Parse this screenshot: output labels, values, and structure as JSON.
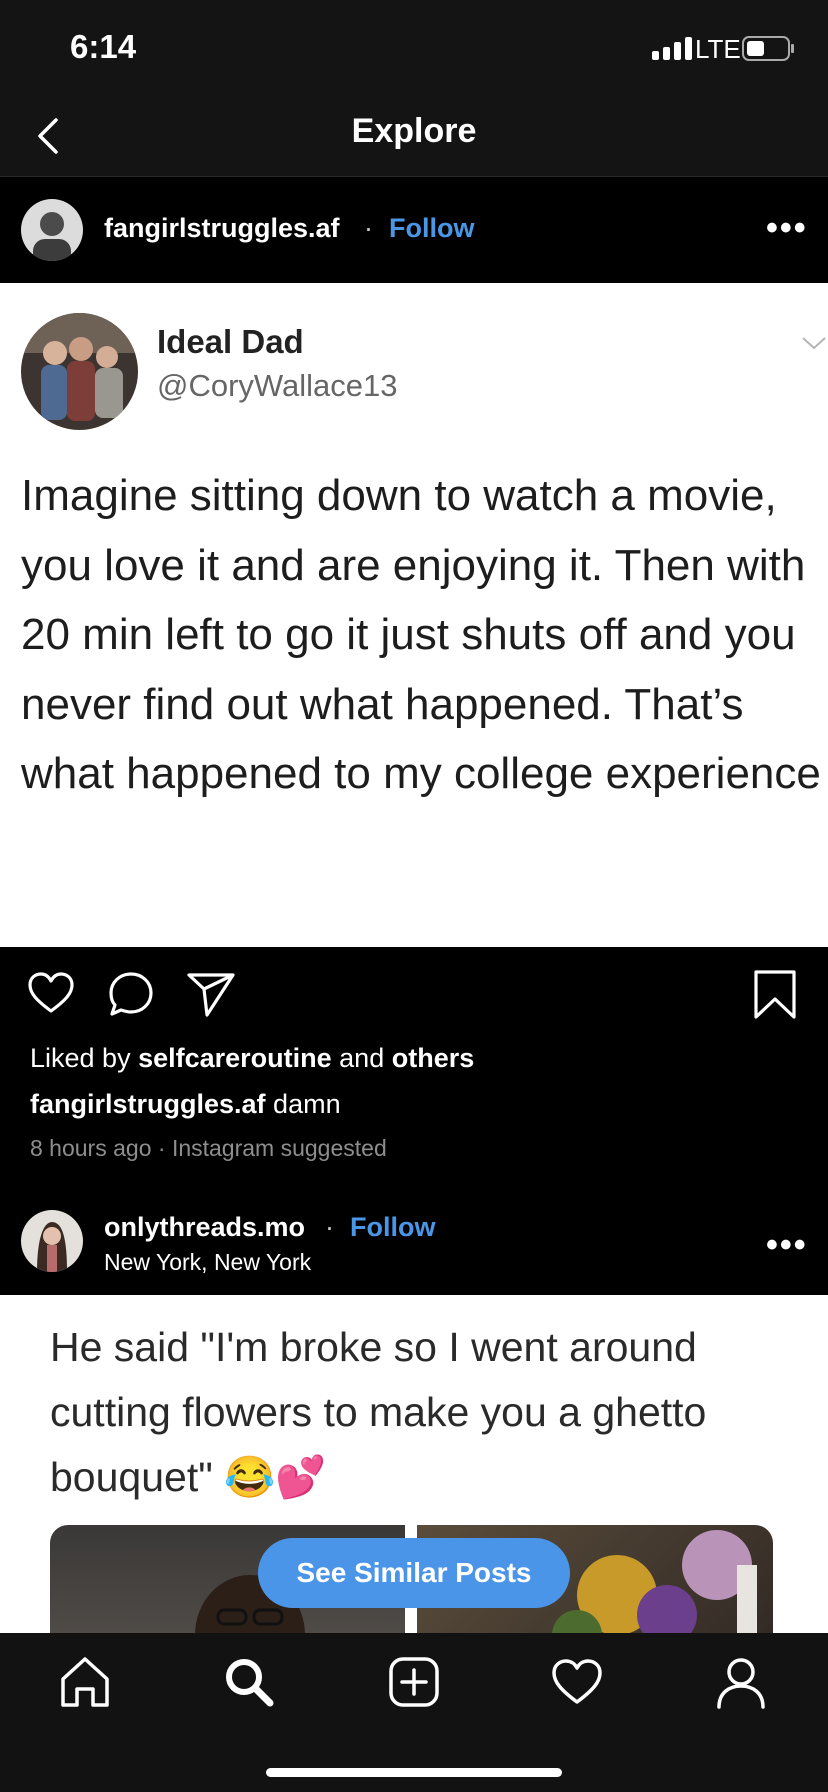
{
  "status_bar": {
    "time": "6:14",
    "network": "LTE"
  },
  "nav": {
    "title": "Explore",
    "back_icon": "chevron-left-icon"
  },
  "post1": {
    "username": "fangirlstruggles.af",
    "separator": "·",
    "follow_label": "Follow",
    "more_label": "•••",
    "tweet": {
      "name": "Ideal Dad",
      "handle": "@CoryWallace13",
      "text": "Imagine sitting down to watch a movie, you love it and are enjoying it. Then with 20 min left to go it just shuts off and you never find out what happened. That’s what happened to my college experience"
    },
    "liked_prefix": "Liked by ",
    "liked_user": "selfcareroutine",
    "liked_and": " and ",
    "liked_others": "others",
    "caption_user": "fangirlstruggles.af",
    "caption_text": " damn",
    "time_ago": "8 hours ago",
    "meta_sep": " · ",
    "suggested": "Instagram suggested"
  },
  "post2": {
    "username": "onlythreads.mo",
    "separator": "·",
    "follow_label": "Follow",
    "location": "New York, New York",
    "more_label": "•••",
    "text": "He said \"I'm broke so I went around cutting flowers to make you a ghetto bouquet\" 😂💕"
  },
  "see_similar_label": "See Similar Posts",
  "colors": {
    "accent": "#4a97e8",
    "button": "#4b95e9",
    "background": "#000000"
  },
  "tabbar": [
    "home-icon",
    "search-icon",
    "add-post-icon",
    "activity-heart-icon",
    "profile-icon"
  ]
}
